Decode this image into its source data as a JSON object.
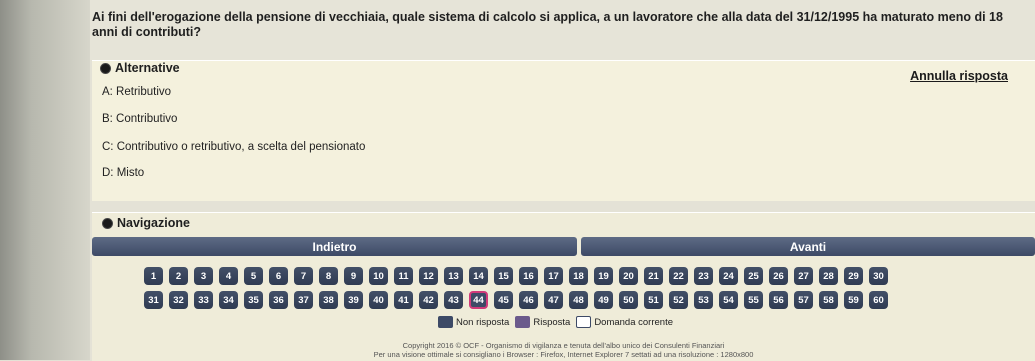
{
  "question": {
    "text": "Ai fini dell'erogazione della pensione di vecchiaia, quale sistema di calcolo si applica, a un lavoratore che alla data del 31/12/1995 ha maturato meno di 18 anni di contributi?"
  },
  "answers": {
    "header": "Alternative",
    "cancel_label": "Annulla risposta",
    "options": [
      "A: Retributivo",
      "B: Contributivo",
      "C: Contributivo o retributivo, a scelta del pensionato",
      "D: Misto"
    ]
  },
  "navigation": {
    "header": "Navigazione",
    "back_label": "Indietro",
    "next_label": "Avanti",
    "current_question": "44",
    "questions_row1": [
      "1",
      "2",
      "3",
      "4",
      "5",
      "6",
      "7",
      "8",
      "9",
      "10",
      "11",
      "12",
      "13",
      "14",
      "15",
      "16",
      "17",
      "18",
      "19",
      "20",
      "21",
      "22",
      "23",
      "24",
      "25",
      "26",
      "27",
      "28",
      "29",
      "30"
    ],
    "questions_row2": [
      "31",
      "32",
      "33",
      "34",
      "35",
      "36",
      "37",
      "38",
      "39",
      "40",
      "41",
      "42",
      "43",
      "44",
      "45",
      "46",
      "47",
      "48",
      "49",
      "50",
      "51",
      "52",
      "53",
      "54",
      "55",
      "56",
      "57",
      "58",
      "59",
      "60"
    ],
    "legend": {
      "not_answered": "Non risposta",
      "answered": "Risposta",
      "current": "Domanda corrente"
    }
  },
  "footer": {
    "copyright": "Copyright 2016 © OCF - Organismo di vigilanza e tenuta dell'albo unico dei Consulenti Finanziari",
    "advice": "Per una visione ottimale si consigliano i  Browser : Firefox, Internet Explorer 7 settati ad una  risoluzione : 1280x800"
  },
  "colors": {
    "question_box": "#3d4a66",
    "current_border": "#d03a7a",
    "panel_bg": "#f4f1dd"
  }
}
